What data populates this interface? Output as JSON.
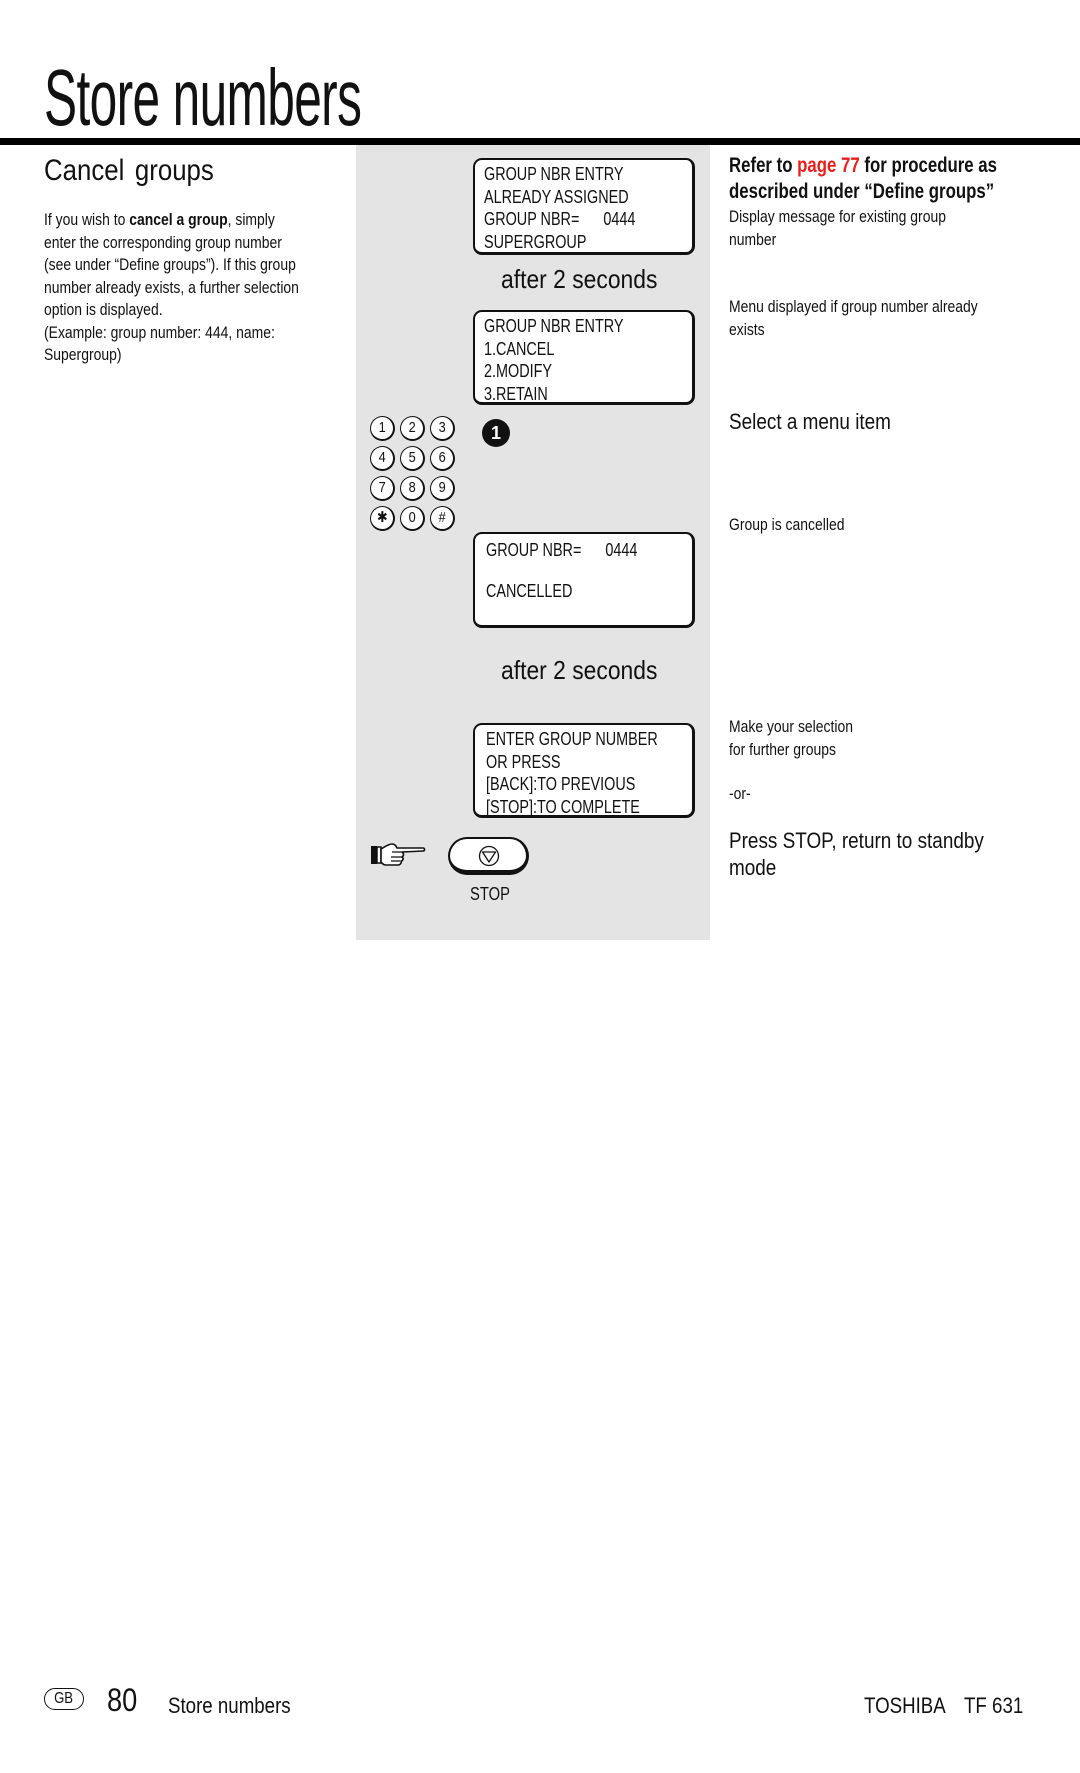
{
  "header": {
    "title": "Store numbers"
  },
  "section": {
    "title": "Cancel groups",
    "intro": {
      "pre": "If you wish to ",
      "bold": "cancel a group",
      "post": ", simply",
      "lines": [
        "enter the corresponding group number",
        "(see under “Define groups”). If this group",
        "number already exists, a further selection",
        "option is displayed.",
        "(Example: group number: 444, name:",
        "Supergroup)"
      ]
    }
  },
  "displays": [
    {
      "rows": [
        "GROUP NBR ENTRY",
        "ALREADY ASSIGNED",
        "GROUP NBR=",
        "SUPERGROUP"
      ],
      "value": "0444"
    },
    {
      "rows": [
        "GROUP NBR ENTRY",
        "1.CANCEL",
        "2.MODIFY",
        "3.RETAIN"
      ]
    },
    {
      "rows": [
        "GROUP NBR=",
        "CANCELLED"
      ],
      "value": "0444"
    },
    {
      "rows": [
        "ENTER GROUP NUMBER",
        "OR PRESS",
        "[BACK]:TO PREVIOUS",
        "[STOP]:TO COMPLETE"
      ]
    }
  ],
  "delays": [
    "after 2 seconds",
    "after 2 seconds"
  ],
  "keypad": {
    "keys": [
      "1",
      "2",
      "3",
      "4",
      "5",
      "6",
      "7",
      "8",
      "9",
      "*",
      "0",
      "#"
    ],
    "pressed": "1"
  },
  "stop_button": {
    "label": "STOP",
    "icon": "stop-triangle-icon"
  },
  "hand_icon": "pointing-hand-icon",
  "instructions": {
    "refer_pre": "Refer to ",
    "refer_link": "page 77",
    "refer_post": " for procedure as",
    "refer_line2": "described under “Define groups”",
    "refer_desc": [
      "Display message for existing group",
      "number"
    ],
    "menu_desc": [
      "Menu displayed if group number already",
      "exists"
    ],
    "select_menu": "Select a menu item",
    "group_cancelled": "Group is cancelled",
    "make_selection": [
      "Make your selection",
      "for further groups"
    ],
    "or": "-or-",
    "press_stop": [
      "Press STOP, return to standby",
      "mode"
    ]
  },
  "footer": {
    "country": "GB",
    "page_number": "80",
    "section": "Store numbers",
    "brand": "TOSHIBA",
    "model": "TF 631"
  },
  "colors": {
    "link_red": "#e8201c",
    "panel_gray": "#e4e4e4"
  }
}
